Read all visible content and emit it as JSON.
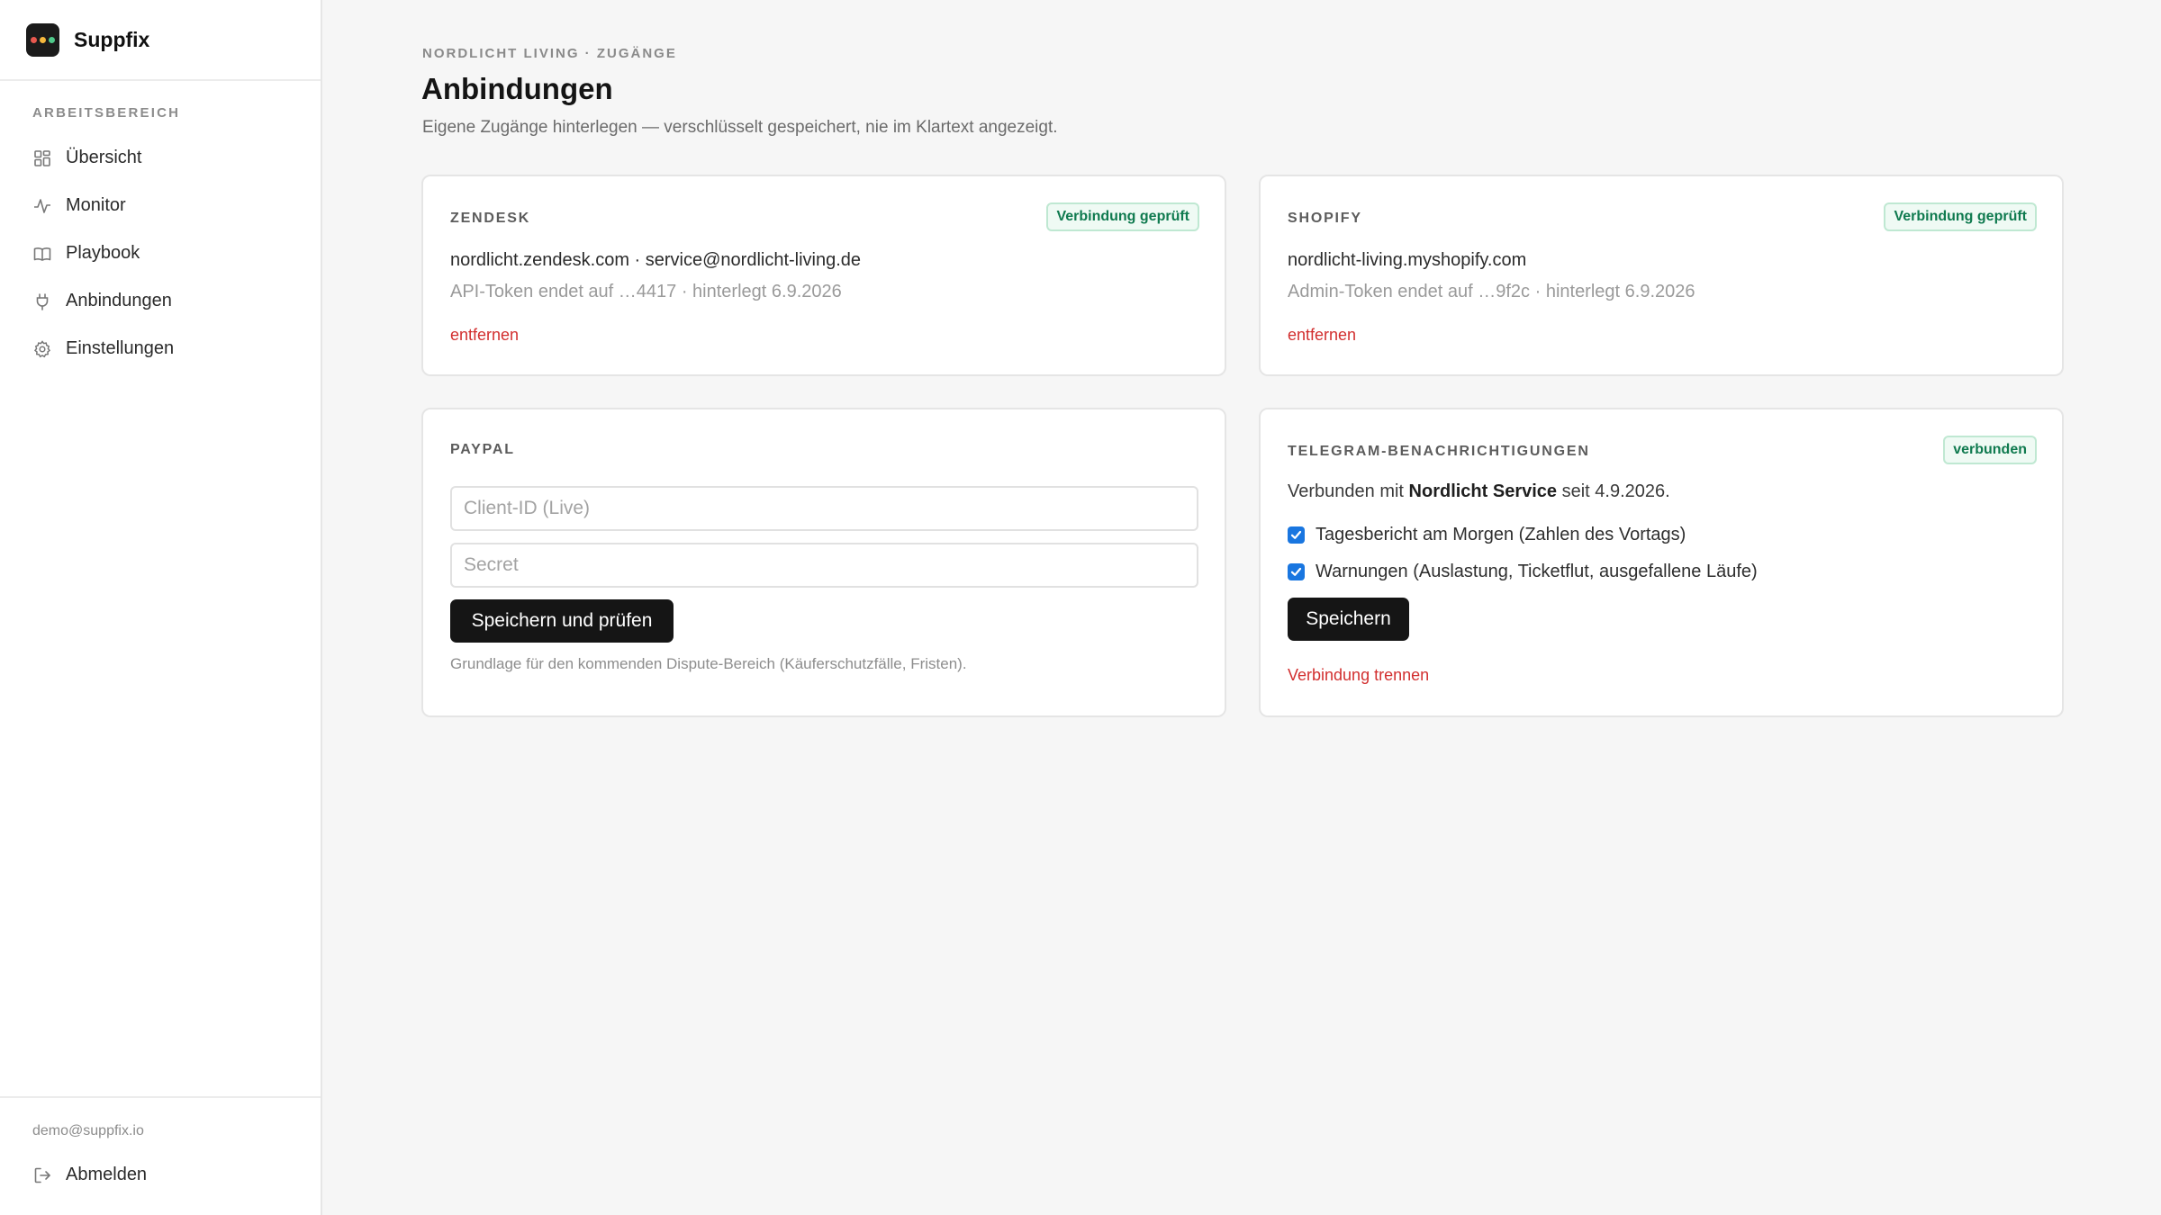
{
  "app": {
    "name": "Suppfix",
    "logo_dots": [
      "#e8584f",
      "#f5b83d",
      "#4fc98a"
    ]
  },
  "sidebar": {
    "section_label": "ARBEITSBEREICH",
    "items": [
      {
        "label": "Übersicht",
        "icon": "grid-icon"
      },
      {
        "label": "Monitor",
        "icon": "activity-icon"
      },
      {
        "label": "Playbook",
        "icon": "book-icon"
      },
      {
        "label": "Anbindungen",
        "icon": "plug-icon"
      },
      {
        "label": "Einstellungen",
        "icon": "gear-icon"
      }
    ],
    "user_email": "demo@suppfix.io",
    "logout_label": "Abmelden"
  },
  "header": {
    "eyebrow": "NORDLICHT LIVING · ZUGÄNGE",
    "title": "Anbindungen",
    "subtitle": "Eigene Zugänge hinterlegen — verschlüsselt gespeichert, nie im Klartext angezeigt."
  },
  "cards": {
    "zendesk": {
      "label": "ZENDESK",
      "badge": "Verbindung geprüft",
      "primary": "nordlicht.zendesk.com · service@nordlicht-living.de",
      "secondary": "API-Token endet auf …4417 · hinterlegt 6.9.2026",
      "remove_label": "entfernen"
    },
    "shopify": {
      "label": "SHOPIFY",
      "badge": "Verbindung geprüft",
      "primary": "nordlicht-living.myshopify.com",
      "secondary": "Admin-Token endet auf …9f2c · hinterlegt 6.9.2026",
      "remove_label": "entfernen"
    },
    "paypal": {
      "label": "PAYPAL",
      "client_id_placeholder": "Client-ID (Live)",
      "secret_placeholder": "Secret",
      "submit_label": "Speichern und prüfen",
      "hint": "Grundlage für den kommenden Dispute-Bereich (Käuferschutzfälle, Fristen)."
    },
    "telegram": {
      "label": "TELEGRAM-BENACHRICHTIGUNGEN",
      "badge": "verbunden",
      "connected_prefix": "Verbunden mit ",
      "connected_name": "Nordlicht Service",
      "connected_suffix": " seit 4.9.2026.",
      "options": [
        {
          "label": "Tagesbericht am Morgen (Zahlen des Vortags)",
          "checked": true
        },
        {
          "label": "Warnungen (Auslastung, Ticketflut, ausgefallene Läufe)",
          "checked": true
        }
      ],
      "save_label": "Speichern",
      "disconnect_label": "Verbindung trennen"
    }
  }
}
